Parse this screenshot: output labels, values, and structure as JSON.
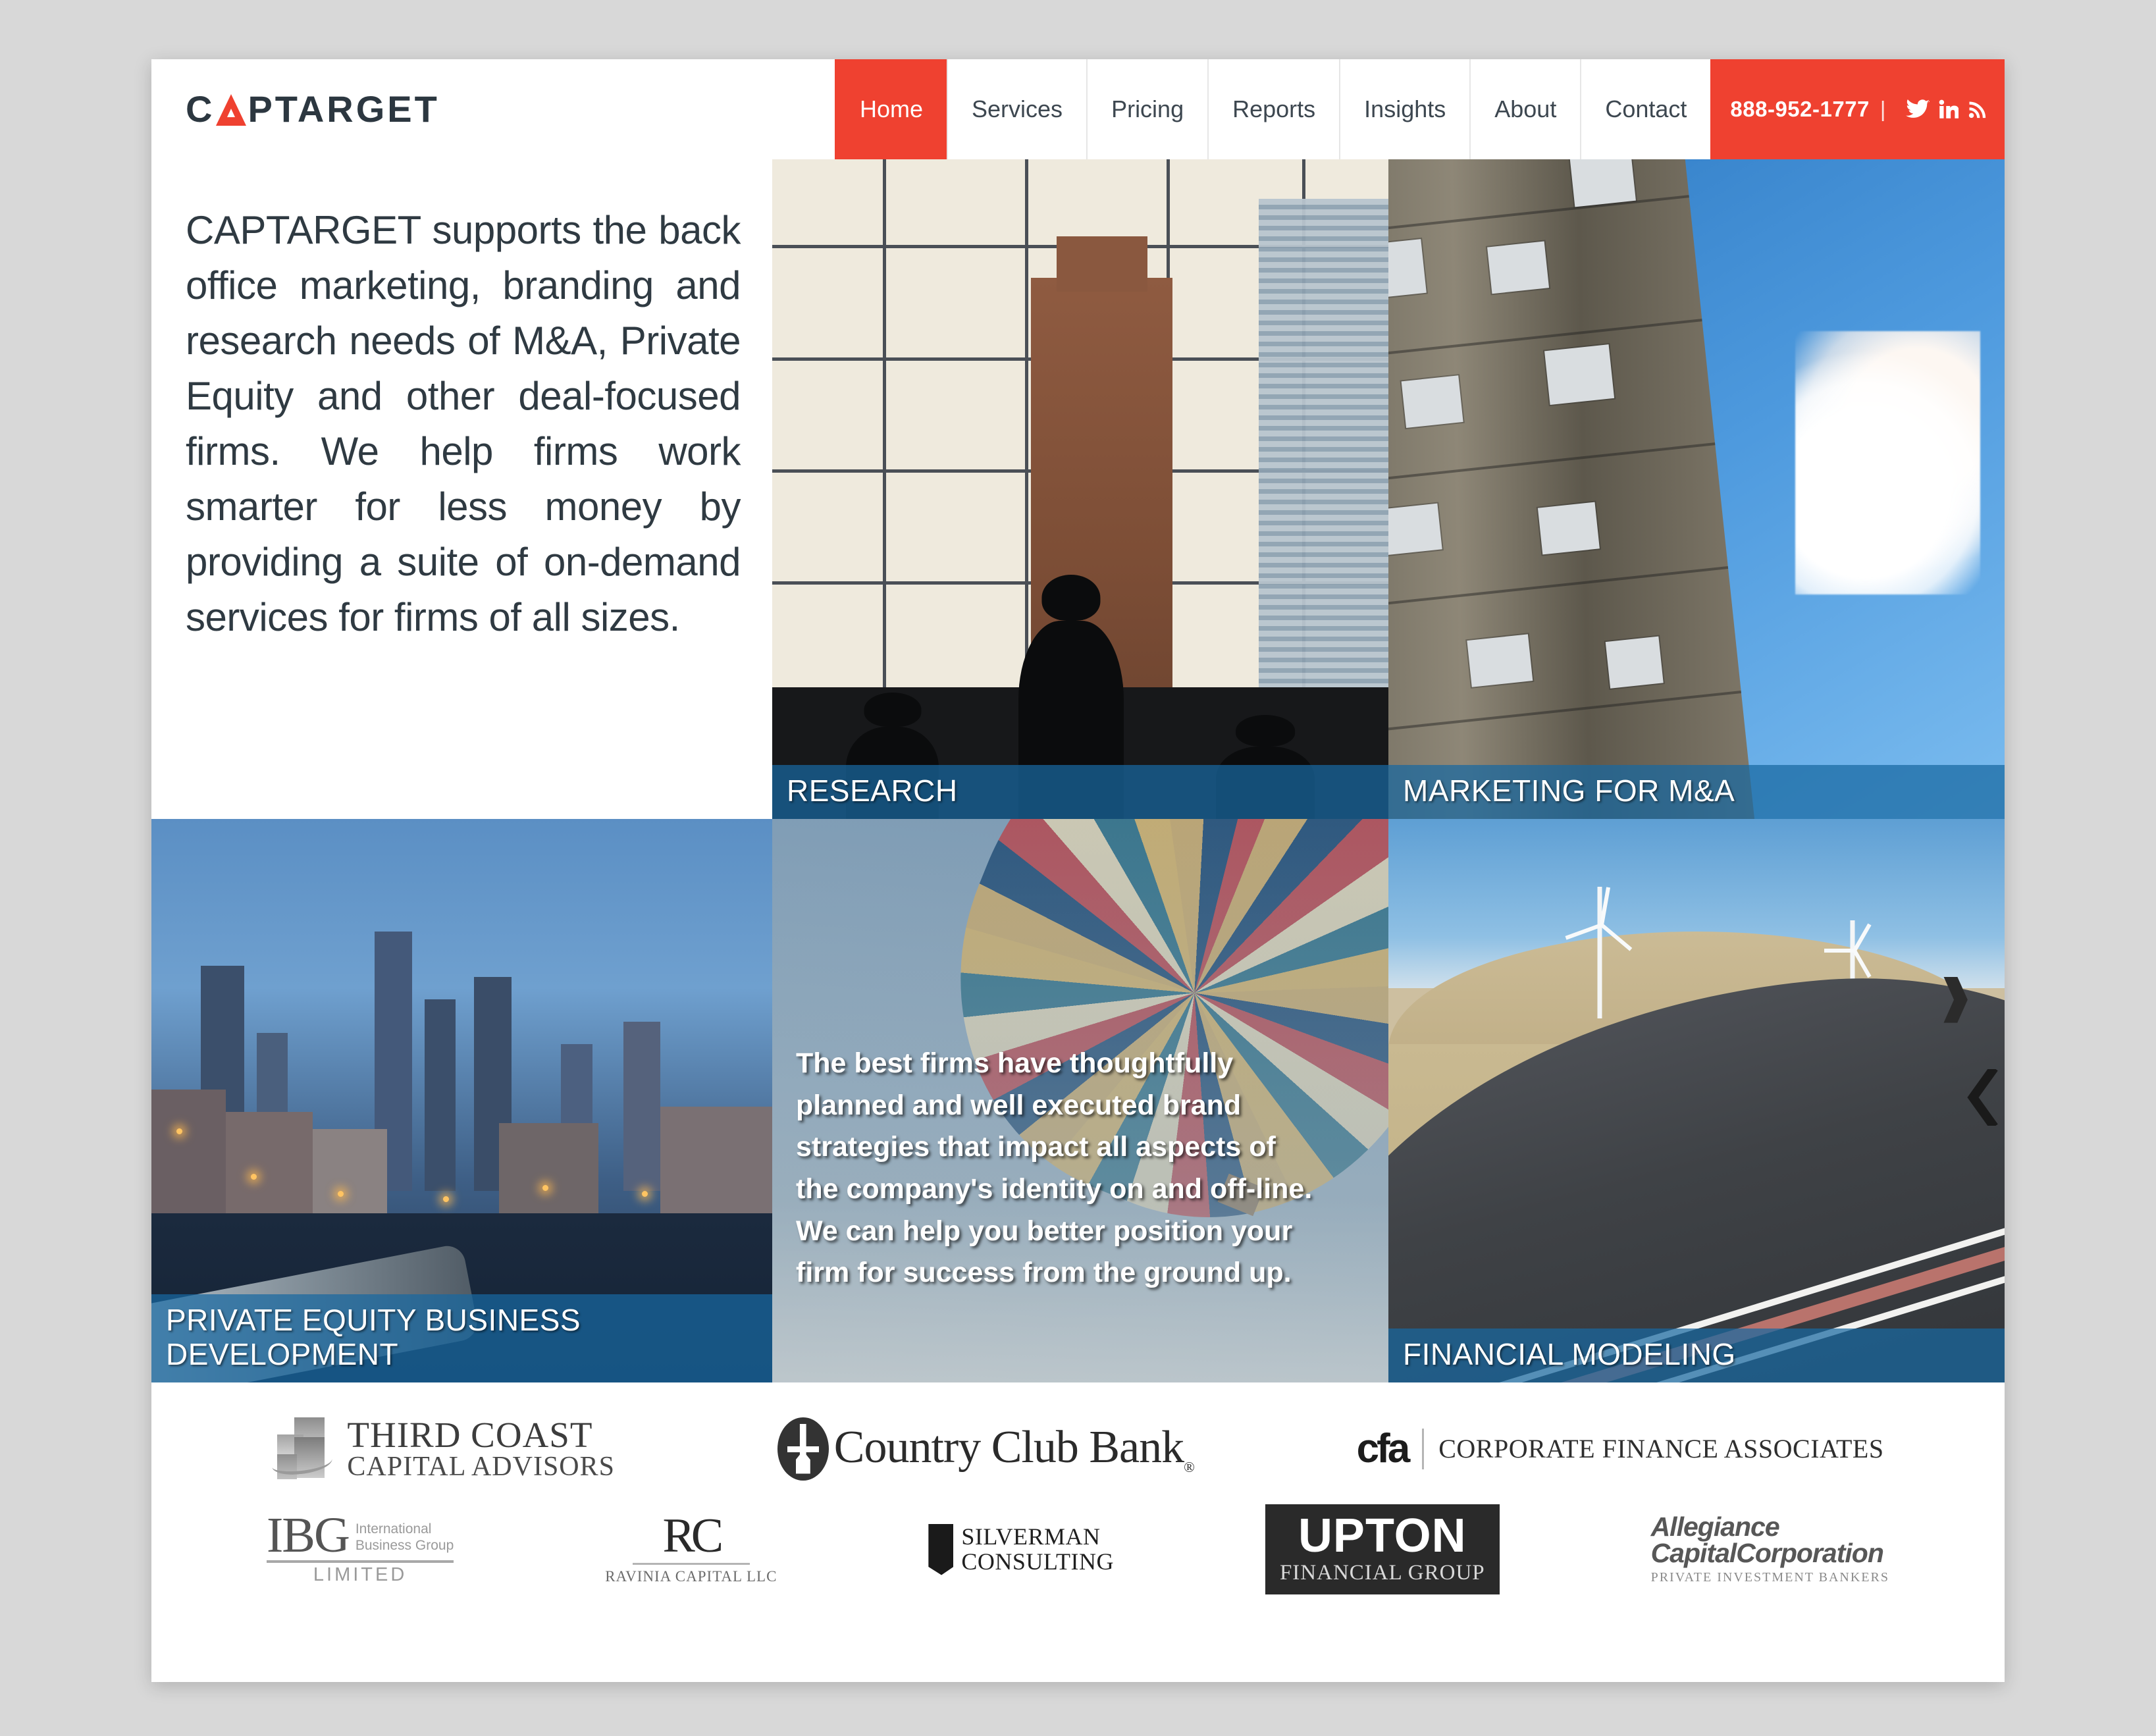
{
  "header": {
    "logo_text_before": "C",
    "logo_icon": "red-triangle-a",
    "logo_text_after": "PTARGET",
    "logo_full": "CAPTARGET",
    "nav": [
      {
        "label": "Home",
        "active": true
      },
      {
        "label": "Services",
        "active": false
      },
      {
        "label": "Pricing",
        "active": false
      },
      {
        "label": "Reports",
        "active": false
      },
      {
        "label": "Insights",
        "active": false
      },
      {
        "label": "About",
        "active": false
      },
      {
        "label": "Contact",
        "active": false
      }
    ],
    "phone": "888-952-1777",
    "separator": "|",
    "social": [
      "twitter-icon",
      "linkedin-icon",
      "rss-icon"
    ]
  },
  "intro": {
    "paragraph": "CAPTARGET supports the back office marketing, branding and research needs of M&A, Private Equity and other deal-focused firms. We help firms work smarter for less money by providing a suite of on-demand services for firms of all sizes."
  },
  "tiles": {
    "research": {
      "caption": "RESEARCH",
      "image": "office-window-silhouettes"
    },
    "marketing": {
      "caption": "MARKETING FOR M&A",
      "image": "building-facade-sky-cloud"
    },
    "private_equity": {
      "caption": "PRIVATE EQUITY BUSINESS\nDEVELOPMENT",
      "image": "waterfront-city-at-dusk"
    },
    "branding": {
      "caption": "",
      "image": "hot-air-balloon",
      "overlay_text": "The best firms have thoughtfully planned and well executed brand strategies that impact all aspects of the company's identity on and off-line. We can help you better position your firm for success from the ground up."
    },
    "financial_modeling": {
      "caption": "FINANCIAL MODELING",
      "image": "winding-road-wind-turbines"
    }
  },
  "slider": {
    "prev_arrow": "chevron-left-icon"
  },
  "clients": {
    "row1": [
      {
        "name": "Third Coast Capital Advisors",
        "line1": "THIRD COAST",
        "line2": "CAPITAL ADVISORS"
      },
      {
        "name": "Country Club Bank",
        "text": "Country Club Bank",
        "registered": "®"
      },
      {
        "name": "Corporate Finance Associates",
        "mark": "cfa",
        "text": "CORPORATE FINANCE ASSOCIATES"
      }
    ],
    "row2": [
      {
        "name": "IBG International Business Group Limited",
        "initials": "IBG",
        "sub1": "International",
        "sub2": "Business Group",
        "sub3": "LIMITED"
      },
      {
        "name": "Ravinia Capital LLC",
        "mark": "RC",
        "sub": "RAVINIA CAPITAL LLC"
      },
      {
        "name": "Silverman Consulting",
        "line1": "SILVERMAN",
        "line2": "CONSULTING"
      },
      {
        "name": "Upton Financial Group",
        "main": "UPTON",
        "sub": "FINANCIAL GROUP"
      },
      {
        "name": "Allegiance Capital Corporation",
        "line1": "Allegiance",
        "line2": "CapitalCorporation",
        "sub": "PRIVATE INVESTMENT BANKERS"
      }
    ]
  },
  "colors": {
    "brand_red": "#ef4130",
    "caption_blue": "#1768a1",
    "nav_text": "#3d4750",
    "body_text": "#2f3a42"
  }
}
